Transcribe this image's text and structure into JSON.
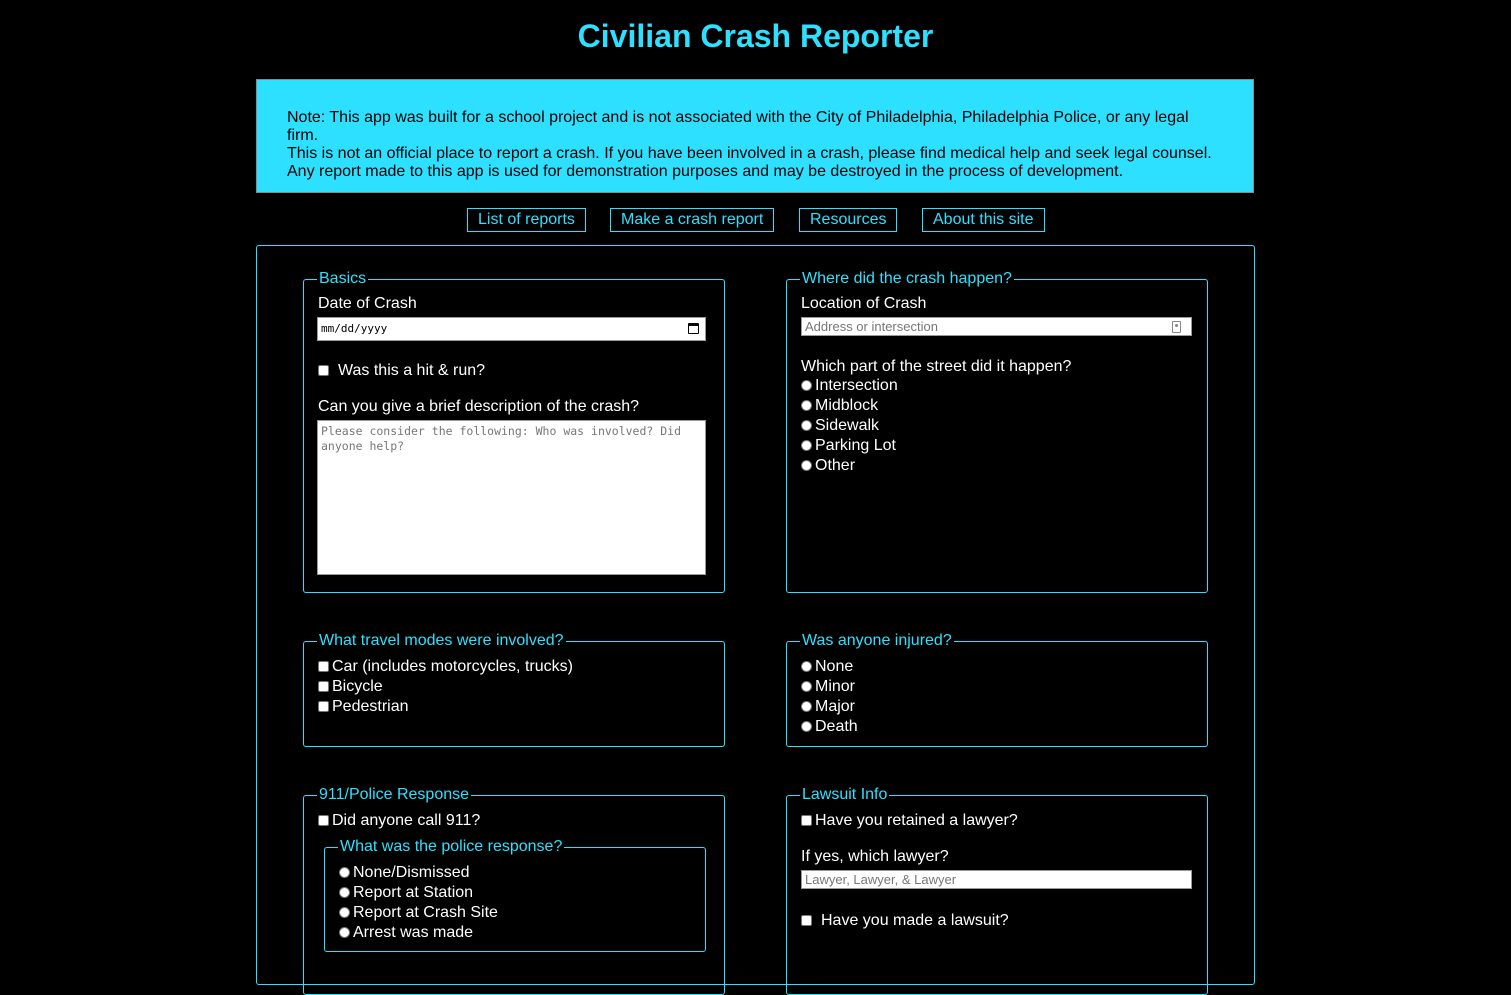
{
  "app": {
    "title": "Civilian Crash Reporter"
  },
  "note": {
    "line1": "Note: This app was built for a school project and is not associated with the City of Philadelphia, Philadelphia Police, or any legal firm.",
    "line2": "This is not an official place to report a crash. If you have been involved in a crash, please find medical help and seek legal counsel.",
    "line3": "Any report made to this app is used for demonstration purposes and may be destroyed in the process of development."
  },
  "nav": {
    "list_reports": "List of reports",
    "make_report": "Make a crash report",
    "resources": "Resources",
    "about": "About this site"
  },
  "basics": {
    "legend": "Basics",
    "date_label": "Date of Crash",
    "date_placeholder": "mm/dd/yyyy",
    "hit_run_label": "Was this a hit & run?",
    "description_label": "Can you give a brief description of the crash?",
    "description_placeholder": "Please consider the following: Who was involved? Did anyone help?"
  },
  "location": {
    "legend": "Where did the crash happen?",
    "location_label": "Location of Crash",
    "location_placeholder": "Address or intersection",
    "street_part_label": "Which part of the street did it happen?",
    "options": [
      "Intersection",
      "Midblock",
      "Sidewalk",
      "Parking Lot",
      "Other"
    ]
  },
  "modes": {
    "legend": "What travel modes were involved?",
    "options": [
      "Car (includes motorcycles, trucks)",
      "Bicycle",
      "Pedestrian"
    ]
  },
  "injury": {
    "legend": "Was anyone injured?",
    "options": [
      "None",
      "Minor",
      "Major",
      "Death"
    ]
  },
  "police": {
    "legend": "911/Police Response",
    "call_911_label": "Did anyone call 911?",
    "response_legend": "What was the police response?",
    "response_options": [
      "None/Dismissed",
      "Report at Station",
      "Report at Crash Site",
      "Arrest was made"
    ]
  },
  "lawsuit": {
    "legend": "Lawsuit Info",
    "retained_label": "Have you retained a lawyer?",
    "which_label": "If yes, which lawyer?",
    "which_placeholder": "Lawyer, Lawyer, & Lawyer",
    "made_label": "Have you made a lawsuit?"
  },
  "colors": {
    "accent": "#2ee0ff",
    "background": "#000000"
  }
}
